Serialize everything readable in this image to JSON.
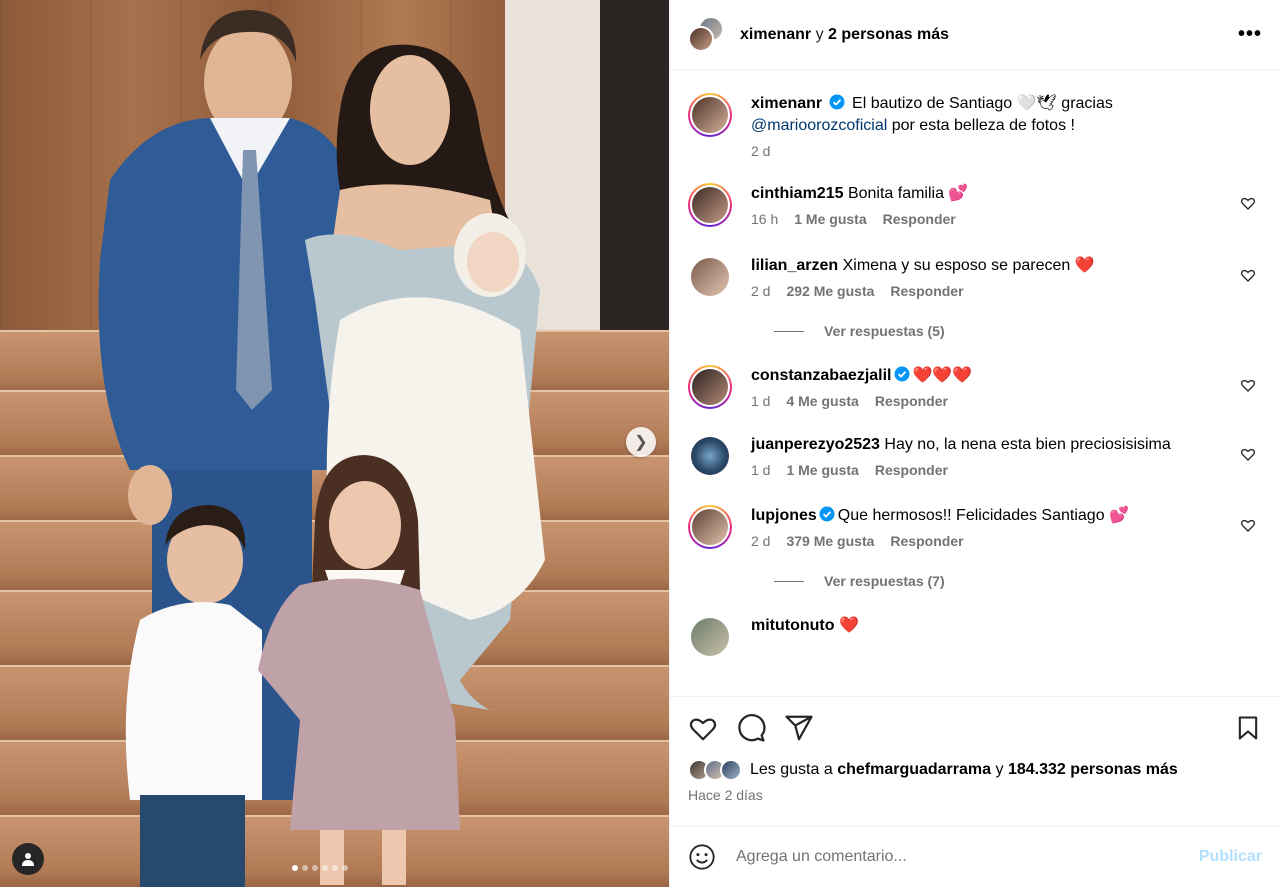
{
  "header": {
    "username": "ximenanr",
    "connector": "y",
    "others": "2 personas más"
  },
  "caption": {
    "username": "ximenanr",
    "text_before": "El bautizo de Santiago 🤍🕊 gracias",
    "mention": "@mariooroz­coficial",
    "text_after": "por esta belleza de fotos !",
    "time": "2 d"
  },
  "comments": [
    {
      "username": "cinthiam215",
      "verified": false,
      "text": "Bonita familia 💕",
      "time": "16 h",
      "likes": "1 Me gusta",
      "reply": "Responder"
    },
    {
      "username": "lilian_arzen",
      "verified": false,
      "text": "Ximena y su esposo se parecen ❤️",
      "time": "2 d",
      "likes": "292 Me gusta",
      "reply": "Responder",
      "view_replies": "Ver respuestas (5)"
    },
    {
      "username": "constanzabaezjalil",
      "verified": true,
      "text": "❤️❤️❤️",
      "time": "1 d",
      "likes": "4 Me gusta",
      "reply": "Responder"
    },
    {
      "username": "juanperezyo2523",
      "verified": false,
      "text": "Hay no, la nena esta bien preciosisisima",
      "time": "1 d",
      "likes": "1 Me gusta",
      "reply": "Responder"
    },
    {
      "username": "lupjones",
      "verified": true,
      "text": "Que hermosos!! Felicidades Santiago 💕",
      "time": "2 d",
      "likes": "379 Me gusta",
      "reply": "Responder",
      "view_replies": "Ver respuestas (7)"
    },
    {
      "username": "mitutonuto",
      "verified": false,
      "text": "❤️",
      "time": "",
      "likes": "",
      "reply": ""
    }
  ],
  "likes": {
    "prefix": "Les gusta a",
    "user": "chefmarguadarrama",
    "connector": "y",
    "count": "184.332 personas más"
  },
  "posted": "Hace 2 días",
  "composer": {
    "placeholder": "Agrega un comentario...",
    "post_label": "Publicar"
  },
  "carousel": {
    "total": 6,
    "current": 1
  },
  "colors": {
    "link": "#00376b",
    "muted": "#737373",
    "verified": "#0095f6",
    "post_disabled": "#b2dffc"
  }
}
